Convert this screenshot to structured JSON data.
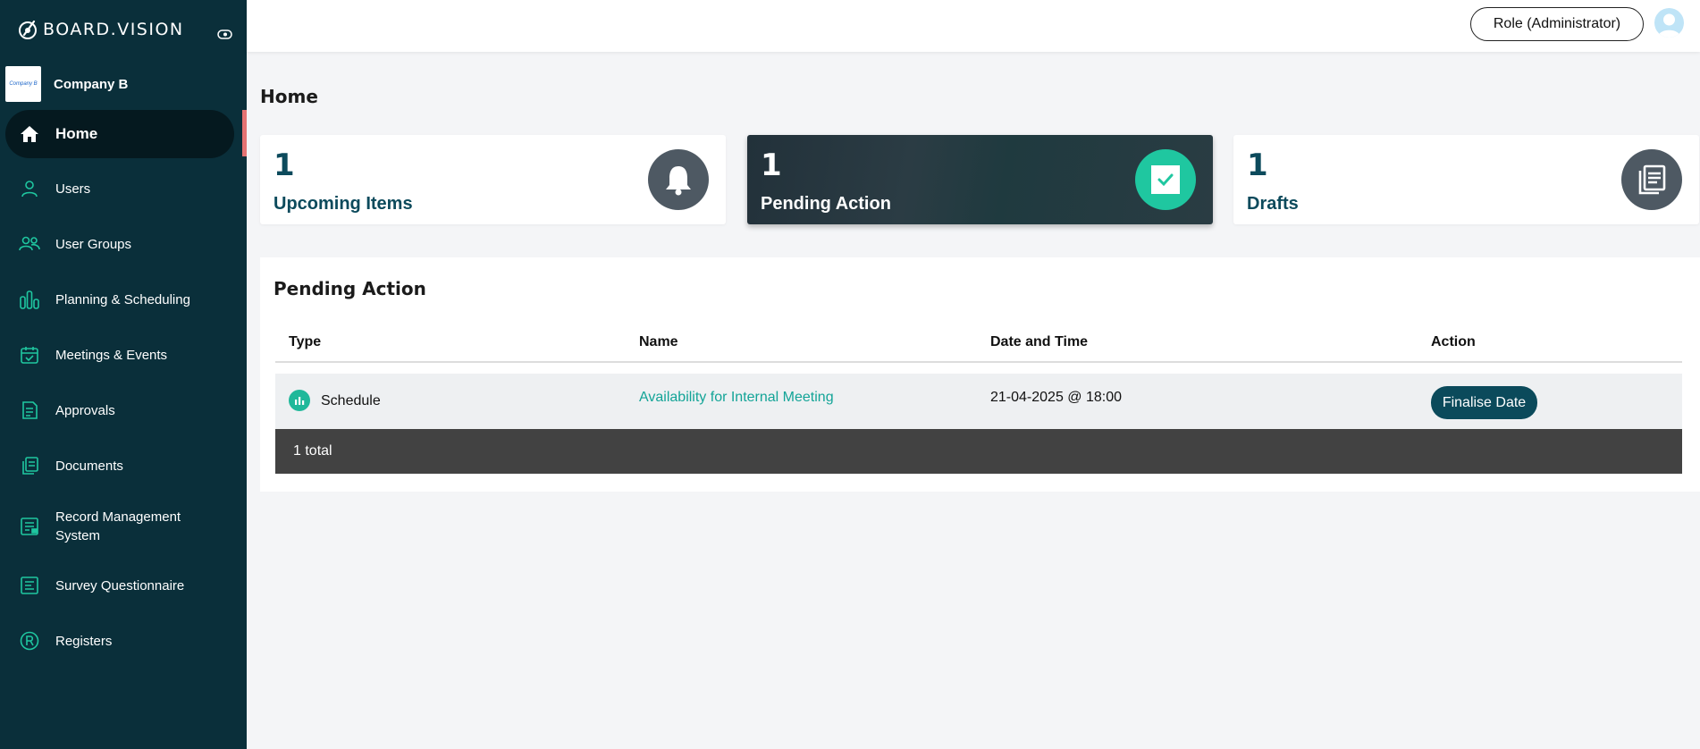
{
  "app": {
    "logo_text": "BOARD.VISION"
  },
  "company": {
    "name": "Company B",
    "logo_text": "Company B"
  },
  "sidebar": {
    "items": [
      {
        "label": "Home",
        "icon": "home-icon",
        "active": true
      },
      {
        "label": "Users",
        "icon": "user-icon"
      },
      {
        "label": "User Groups",
        "icon": "user-group-icon"
      },
      {
        "label": "Planning & Scheduling",
        "icon": "bar-chart-icon"
      },
      {
        "label": "Meetings & Events",
        "icon": "calendar-icon"
      },
      {
        "label": "Approvals",
        "icon": "approval-icon"
      },
      {
        "label": "Documents",
        "icon": "documents-icon"
      },
      {
        "label": "Record Management System",
        "icon": "record-icon"
      },
      {
        "label": "Survey Questionnaire",
        "icon": "survey-icon"
      },
      {
        "label": "Registers",
        "icon": "registered-icon"
      }
    ]
  },
  "topbar": {
    "role_label": "Role (Administrator)"
  },
  "page": {
    "title": "Home"
  },
  "cards": [
    {
      "count": "1",
      "label": "Upcoming Items",
      "icon": "bell-icon"
    },
    {
      "count": "1",
      "label": "Pending Action",
      "icon": "checkbox-icon",
      "highlighted": true
    },
    {
      "count": "1",
      "label": "Drafts",
      "icon": "drafts-icon"
    }
  ],
  "pending": {
    "title": "Pending Action",
    "columns": [
      "Type",
      "Name",
      "Date and Time",
      "Action"
    ],
    "rows": [
      {
        "type": "Schedule",
        "name": "Availability for Internal Meeting",
        "datetime": "21-04-2025 @ 18:00",
        "action": "Finalise Date"
      }
    ],
    "footer": "1 total"
  },
  "colors": {
    "sidebar": "#0a2f3a",
    "accent": "#1fc7a0",
    "primary": "#0b4a5b",
    "link": "#13a497"
  }
}
